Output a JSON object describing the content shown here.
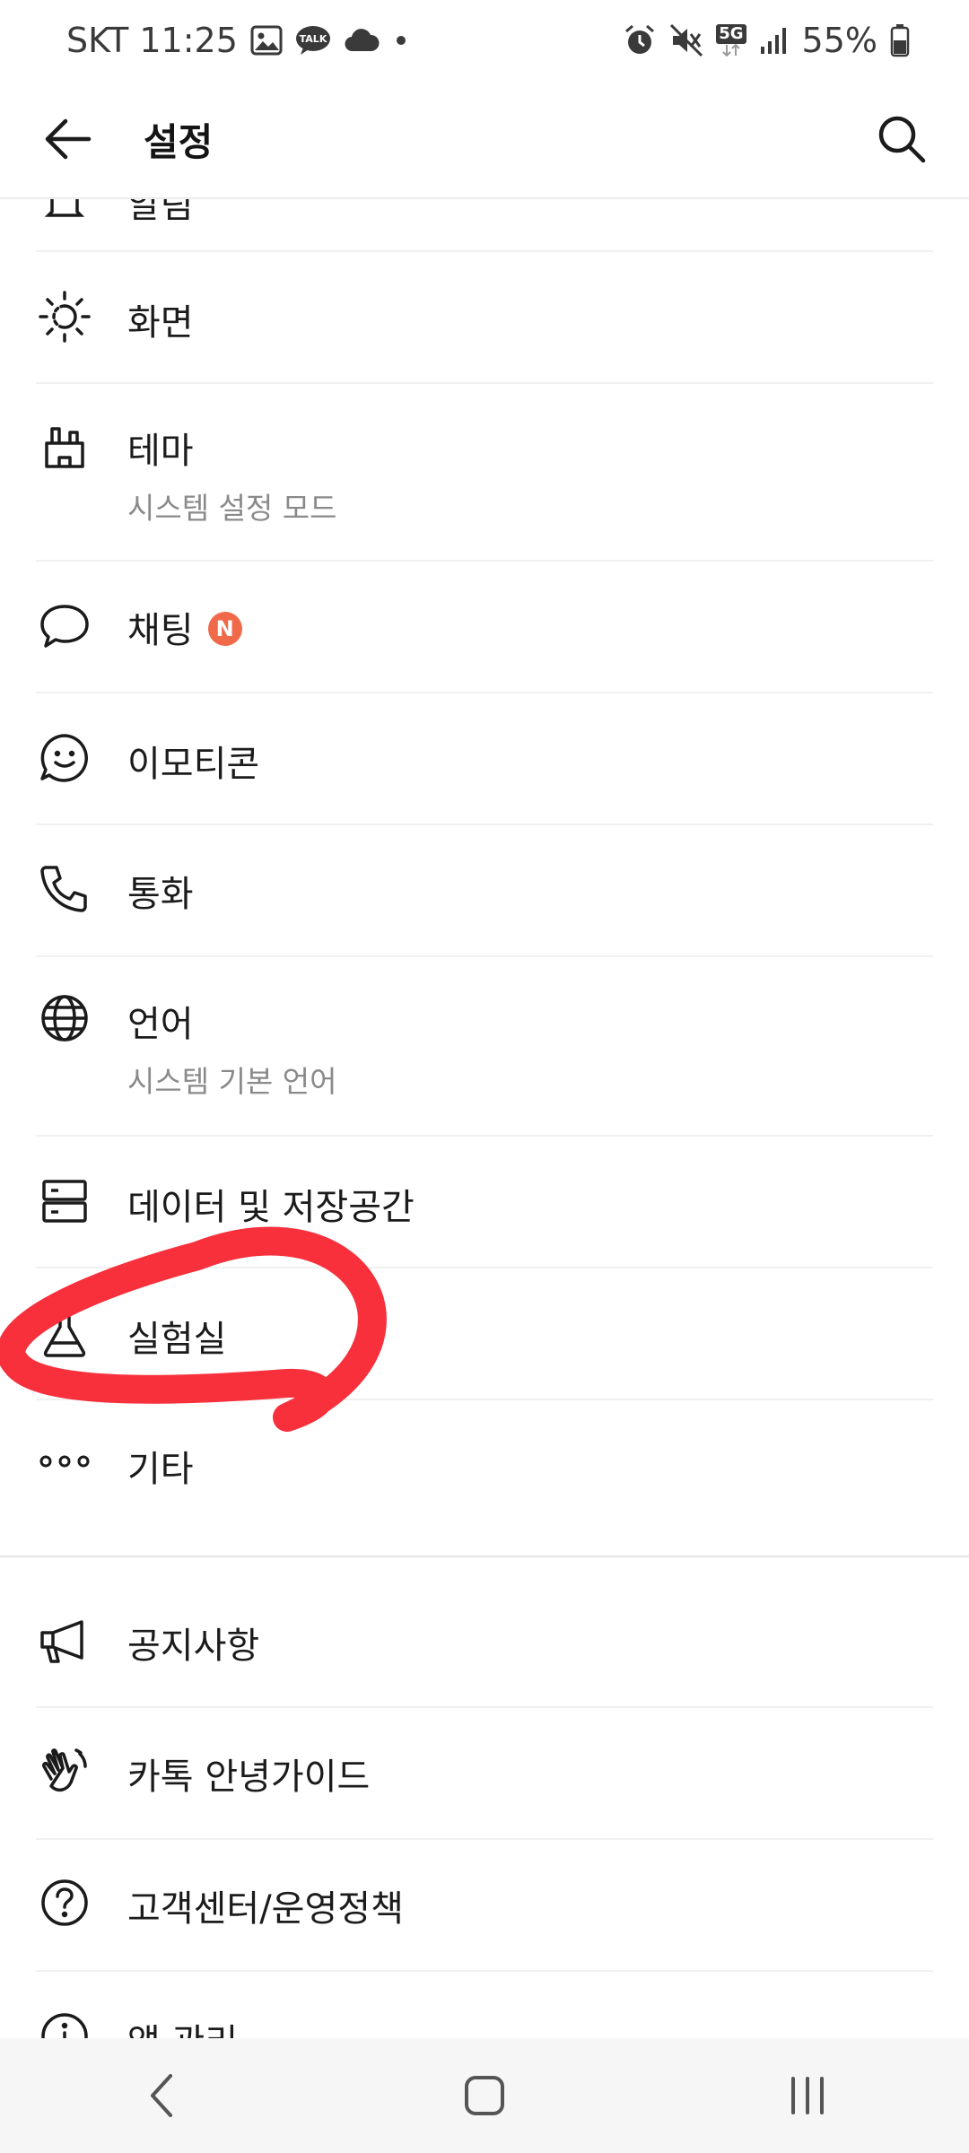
{
  "status_bar": {
    "carrier_time": "SKT 11:25",
    "network": "5G",
    "battery": "55%"
  },
  "app_bar": {
    "title": "설정"
  },
  "settings": {
    "partial_top_label": "알림",
    "display": "화면",
    "theme": "테마",
    "theme_sub": "시스템 설정 모드",
    "chat": "채팅",
    "chat_badge": "N",
    "emoticon": "이모티콘",
    "call": "통화",
    "language": "언어",
    "language_sub": "시스템 기본 언어",
    "data_storage": "데이터 및 저장공간",
    "lab": "실험실",
    "etc": "기타",
    "notice": "공지사항",
    "guide": "카톡 안녕가이드",
    "help": "고객센터/운영정책",
    "app_management": "앱 관리"
  },
  "colors": {
    "badge": "#f06a4a",
    "annotation": "#f8303c"
  }
}
